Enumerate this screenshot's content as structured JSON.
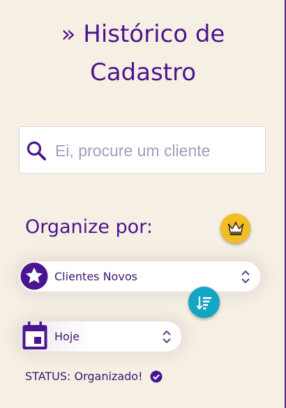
{
  "header": {
    "title_line1": "» Histórico de",
    "title_line2": "Cadastro"
  },
  "search": {
    "placeholder": "Ei, procure um cliente",
    "value": "",
    "icon": "search-icon"
  },
  "organize": {
    "label": "Organize por:",
    "premium_icon": "crown-icon",
    "sort_icon": "sort-descending-icon"
  },
  "filters": {
    "order_select": {
      "selected": "Clientes Novos",
      "icon": "star-icon"
    },
    "period_select": {
      "selected": "Hoje",
      "icon": "calendar-icon"
    }
  },
  "status": {
    "text": "STATUS: Organizado!",
    "icon": "check-circle-icon"
  },
  "colors": {
    "primary": "#4a1590",
    "background": "#f6efe3",
    "premium": "#f1bd22",
    "sort": "#12a5c4"
  }
}
